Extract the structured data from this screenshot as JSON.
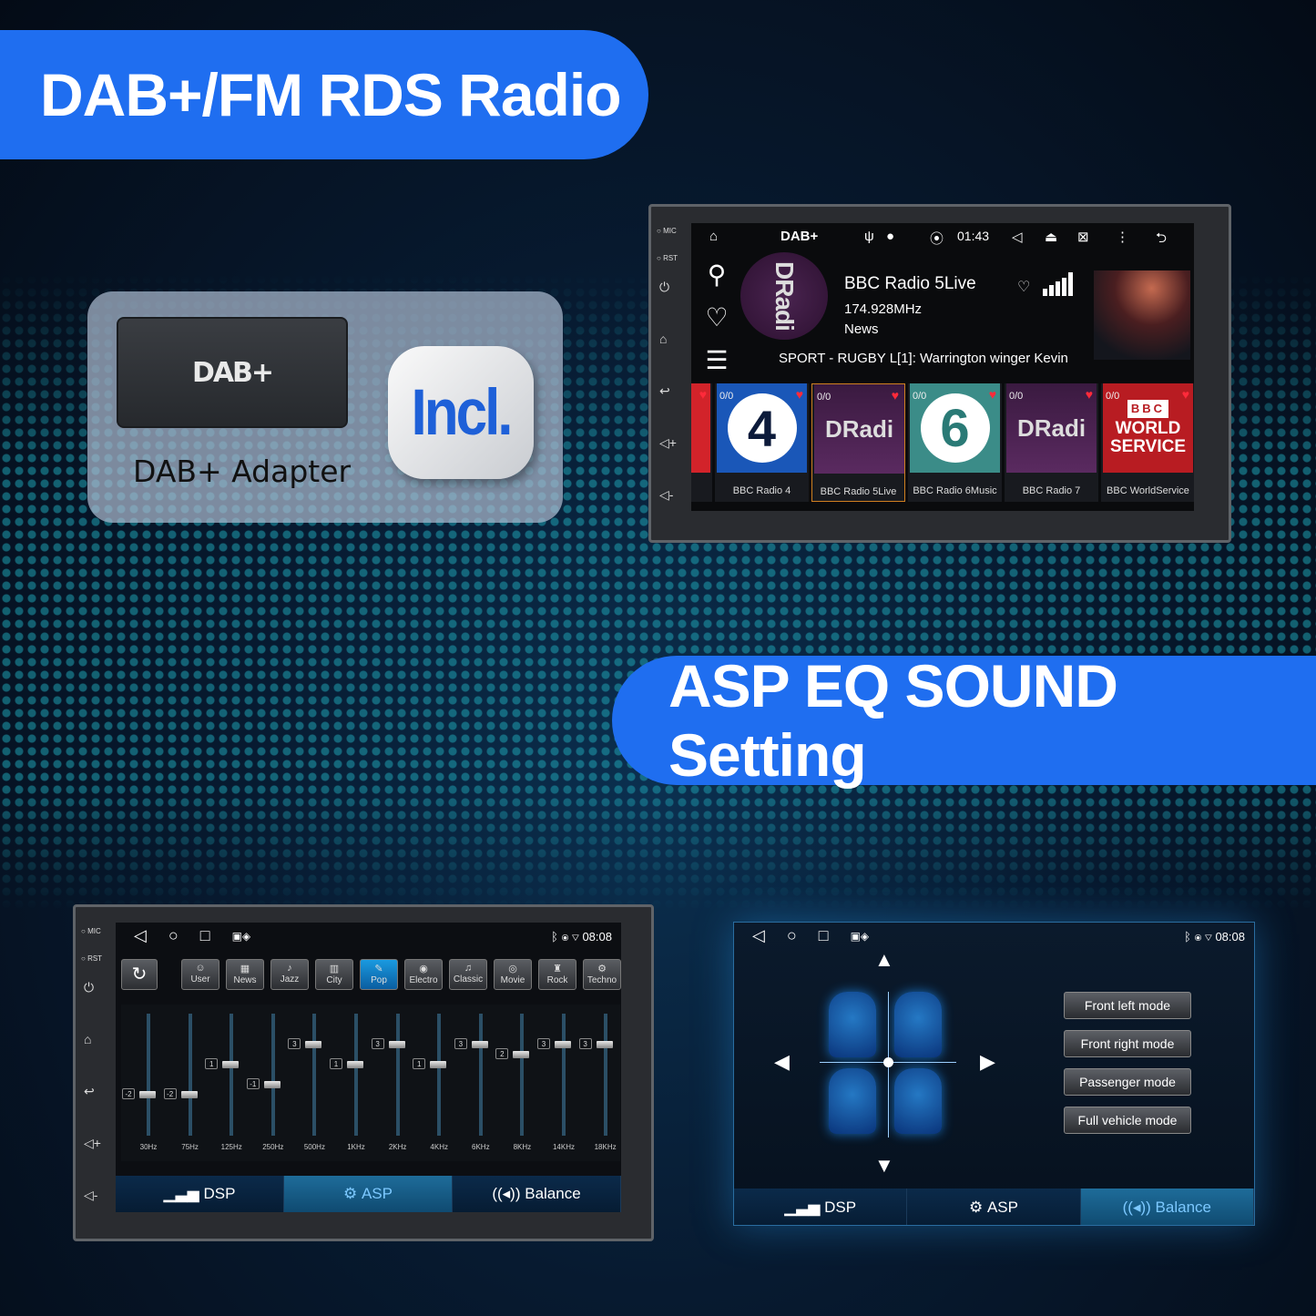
{
  "banners": {
    "top": "DAB+/FM RDS Radio",
    "middle": "ASP EQ SOUND Setting"
  },
  "adapter": {
    "dongle_label": "DAB+",
    "label": "DAB+ Adapter",
    "badge": "Incl."
  },
  "device_side": {
    "mic": "MIC",
    "rst": "RST"
  },
  "dab_screen": {
    "app": "DAB+",
    "time": "01:43",
    "station": "BBC Radio 5Live",
    "frequency": "174.928MHz",
    "genre": "News",
    "logo_text": "DRadi",
    "rds_text": "SPORT - RUGBY L[1]: Warrington winger Kevin",
    "tiles": [
      {
        "count": "",
        "art": "",
        "label": ""
      },
      {
        "count": "0/0",
        "art": "4",
        "label": "BBC Radio 4"
      },
      {
        "count": "0/0",
        "art": "DRadi",
        "label": "BBC Radio 5Live"
      },
      {
        "count": "0/0",
        "art": "6",
        "label": "BBC Radio 6Music"
      },
      {
        "count": "0/0",
        "art": "DRadi",
        "label": "BBC Radio 7"
      },
      {
        "count": "0/0",
        "art_line1": "BBC",
        "art_line2": "WORLD",
        "art_line3": "SERVICE",
        "label": "BBC WorldService"
      }
    ]
  },
  "eq_screen": {
    "time": "08:08",
    "presets": [
      "User",
      "News",
      "Jazz",
      "City",
      "Pop",
      "Electro",
      "Classic",
      "Movie",
      "Rock",
      "Techno"
    ],
    "active_preset": "Pop",
    "bands": [
      {
        "freq": "30Hz",
        "val": "-2",
        "level": -2
      },
      {
        "freq": "75Hz",
        "val": "-2",
        "level": -2
      },
      {
        "freq": "125Hz",
        "val": "1",
        "level": 1
      },
      {
        "freq": "250Hz",
        "val": "-1",
        "level": -1
      },
      {
        "freq": "500Hz",
        "val": "3",
        "level": 3
      },
      {
        "freq": "1KHz",
        "val": "1",
        "level": 1
      },
      {
        "freq": "2KHz",
        "val": "3",
        "level": 3
      },
      {
        "freq": "4KHz",
        "val": "1",
        "level": 1
      },
      {
        "freq": "6KHz",
        "val": "3",
        "level": 3
      },
      {
        "freq": "8KHz",
        "val": "2",
        "level": 2
      },
      {
        "freq": "14KHz",
        "val": "3",
        "level": 3
      },
      {
        "freq": "18KHz",
        "val": "3",
        "level": 3
      }
    ],
    "tabs": {
      "dsp": "DSP",
      "asp": "ASP",
      "balance": "Balance"
    }
  },
  "balance_screen": {
    "time": "08:08",
    "modes": [
      "Front left mode",
      "Front right mode",
      "Passenger mode",
      "Full vehicle mode"
    ],
    "tabs": {
      "dsp": "DSP",
      "asp": "ASP",
      "balance": "Balance"
    }
  }
}
